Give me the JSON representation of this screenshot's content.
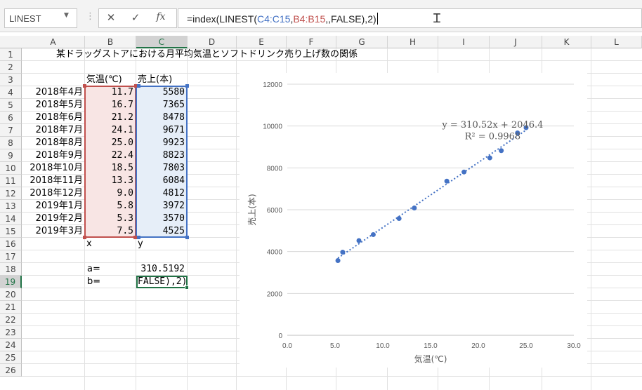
{
  "formula_bar": {
    "name_box": "LINEST",
    "formula_parts": [
      {
        "text": "=index(LINEST(",
        "color": "#222222"
      },
      {
        "text": "C4:C15",
        "color": "#4472c4"
      },
      {
        "text": ",",
        "color": "#222222"
      },
      {
        "text": "B4:B15",
        "color": "#c0504d"
      },
      {
        "text": ",,FALSE),2)",
        "color": "#222222"
      }
    ],
    "cancel_icon": "close-icon",
    "enter_icon": "check-icon",
    "fx_label": "fx"
  },
  "columns": [
    "A",
    "B",
    "C",
    "D",
    "E",
    "F",
    "G",
    "H",
    "I",
    "J",
    "K",
    "L"
  ],
  "rows": [
    "1",
    "2",
    "3",
    "4",
    "5",
    "6",
    "7",
    "8",
    "9",
    "10",
    "11",
    "12",
    "13",
    "14",
    "15",
    "16",
    "17",
    "18",
    "19",
    "20",
    "21",
    "22",
    "23",
    "24",
    "25",
    "26"
  ],
  "sheet": {
    "title": "某ドラッグストアにおける月平均気温とソフトドリンク売り上げ数の関係",
    "header_b": "気温(℃)",
    "header_c": "売上(本)",
    "months": [
      "2018年4月",
      "2018年5月",
      "2018年6月",
      "2018年7月",
      "2018年8月",
      "2018年9月",
      "2018年10月",
      "2018年11月",
      "2018年12月",
      "2019年1月",
      "2019年2月",
      "2019年3月"
    ],
    "temps": [
      "11.7",
      "16.7",
      "21.2",
      "24.1",
      "25.0",
      "22.4",
      "18.5",
      "13.3",
      "9.0",
      "5.8",
      "5.3",
      "7.5"
    ],
    "sales": [
      "5580",
      "7365",
      "8478",
      "9671",
      "9923",
      "8823",
      "7803",
      "6084",
      "4812",
      "3972",
      "3570",
      "4525"
    ],
    "label_x": "x",
    "label_y": "y",
    "label_a": "a=",
    "value_a": "310.5192",
    "label_b": "b=",
    "edit_text": "FALSE),2)"
  },
  "colors": {
    "accent": "#217346",
    "x_range": "#c0504d",
    "y_range": "#4472c4",
    "x_fill": "#f8e5e4",
    "y_fill": "#e6eef8",
    "marker": "#4472c4"
  },
  "chart_data": {
    "type": "scatter",
    "title": "",
    "xlabel": "気温(℃)",
    "ylabel": "売上(本)",
    "xlim": [
      0,
      30
    ],
    "ylim": [
      0,
      12000
    ],
    "xticks": [
      "0.0",
      "5.0",
      "10.0",
      "15.0",
      "20.0",
      "25.0",
      "30.0"
    ],
    "yticks": [
      "0",
      "2000",
      "4000",
      "6000",
      "8000",
      "10000",
      "12000"
    ],
    "grid": true,
    "points": [
      {
        "x": 11.7,
        "y": 5580
      },
      {
        "x": 16.7,
        "y": 7365
      },
      {
        "x": 21.2,
        "y": 8478
      },
      {
        "x": 24.1,
        "y": 9671
      },
      {
        "x": 25.0,
        "y": 9923
      },
      {
        "x": 22.4,
        "y": 8823
      },
      {
        "x": 18.5,
        "y": 7803
      },
      {
        "x": 13.3,
        "y": 6084
      },
      {
        "x": 9.0,
        "y": 4812
      },
      {
        "x": 5.8,
        "y": 3972
      },
      {
        "x": 5.3,
        "y": 3570
      },
      {
        "x": 7.5,
        "y": 4525
      }
    ],
    "trendline": {
      "slope": 310.52,
      "intercept": 2046.4,
      "from": 5.3,
      "to": 25.0
    },
    "equation": "y = 310.52x + 2046.4",
    "r_squared": "R² = 0.9968"
  }
}
